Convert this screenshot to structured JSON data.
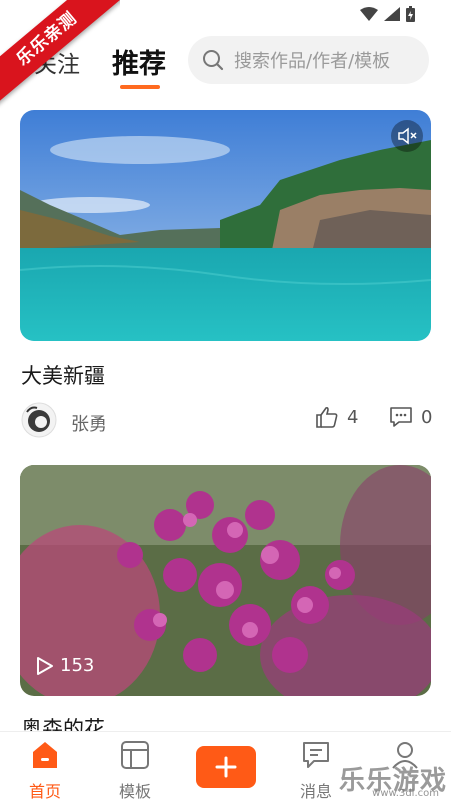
{
  "watermark": {
    "ribbon_text": "乐乐亲测",
    "corner_text": "乐乐游戏",
    "corner_sub": "www.3dl.com"
  },
  "header": {
    "tabs": [
      {
        "label": "关注",
        "active": false
      },
      {
        "label": "推荐",
        "active": true
      }
    ],
    "search": {
      "placeholder": "搜索作品/作者/模板",
      "icon": "search-icon"
    },
    "accent_color": "#ff6a1f"
  },
  "feed": {
    "items": [
      {
        "title": "大美新疆",
        "author": "张勇",
        "likes": "4",
        "comments": "0",
        "media": "lake-landscape-video",
        "muted": true
      },
      {
        "title": "奥森的花",
        "play_count": "153",
        "media": "lilac-flowers-video"
      }
    ]
  },
  "bottom_nav": {
    "items": [
      {
        "label": "首页",
        "icon": "home-icon",
        "active": true
      },
      {
        "label": "模板",
        "icon": "template-icon",
        "active": false
      },
      {
        "label": "",
        "icon": "plus-icon",
        "active": false
      },
      {
        "label": "消息",
        "icon": "message-icon",
        "active": false
      },
      {
        "label": "",
        "icon": "user-icon",
        "active": false
      }
    ]
  }
}
